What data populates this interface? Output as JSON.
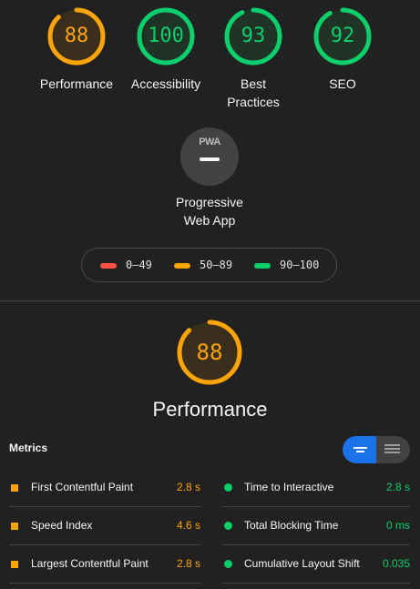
{
  "summary": {
    "gauges": [
      {
        "id": "performance",
        "score": "88",
        "label_lines": [
          "Performance"
        ],
        "fill": 0.88,
        "color": "#ffa400",
        "bg": "#3a2e1c"
      },
      {
        "id": "accessibility",
        "score": "100",
        "label_lines": [
          "Accessibility"
        ],
        "fill": 1.0,
        "color": "#0cce6b",
        "bg": "#1f3326"
      },
      {
        "id": "best-practices",
        "score": "93",
        "label_lines": [
          "Best",
          "Practices"
        ],
        "fill": 0.93,
        "color": "#0cce6b",
        "bg": "#1f3326"
      },
      {
        "id": "seo",
        "score": "92",
        "label_lines": [
          "SEO"
        ],
        "fill": 0.92,
        "color": "#0cce6b",
        "bg": "#1f3326"
      }
    ],
    "pwa": {
      "badge_text": "PWA",
      "label_line1": "Progressive",
      "label_line2": "Web App"
    }
  },
  "legend": [
    {
      "range": "0–49",
      "color": "#ff4e42"
    },
    {
      "range": "50–89",
      "color": "#ffa400"
    },
    {
      "range": "90–100",
      "color": "#0cce6b"
    }
  ],
  "performance": {
    "score": "88",
    "fill": 0.88,
    "title": "Performance",
    "color": "#ffa400"
  },
  "metrics": {
    "title": "Metrics",
    "left": [
      {
        "label": "First Contentful Paint",
        "value": "2.8 s",
        "status": "average"
      },
      {
        "label": "Speed Index",
        "value": "4.6 s",
        "status": "average"
      },
      {
        "label": "Largest Contentful Paint",
        "value": "2.8 s",
        "status": "average"
      }
    ],
    "right": [
      {
        "label": "Time to Interactive",
        "value": "2.8 s",
        "status": "pass"
      },
      {
        "label": "Total Blocking Time",
        "value": "0 ms",
        "status": "pass"
      },
      {
        "label": "Cumulative Layout Shift",
        "value": "0.035",
        "status": "pass"
      }
    ]
  },
  "colors": {
    "pass": "#0cce6b",
    "average": "#ffa400",
    "fail": "#ff4e42",
    "accent": "#1a73e8"
  }
}
